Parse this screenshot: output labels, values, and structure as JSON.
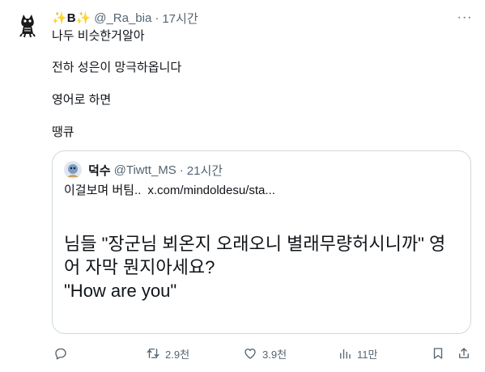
{
  "tweet": {
    "author": {
      "name": "B",
      "handle": "@_Ra_bia",
      "time": "17시간"
    },
    "lines": [
      "나두 비슷한거알아",
      "전하 성은이 망극하옵니다",
      "영어로 하면",
      "땡큐"
    ],
    "quote": {
      "author": {
        "name": "덕수",
        "handle": "@Tiwtt_MS",
        "time": "21시간"
      },
      "text": "이걸보며 버팀..",
      "link": "x.com/mindoldesu/sta...",
      "card_line1": "님들 \"장군님 뵈온지 오래오니 별래무량허시니까\" 영어 자막 뭔지아세요?",
      "card_line2": "\"How are you\""
    },
    "actions": {
      "reply": {
        "icon": "reply-icon",
        "count": ""
      },
      "retweet": {
        "icon": "retweet-icon",
        "count": "2.9천"
      },
      "like": {
        "icon": "heart-icon",
        "count": "3.9천"
      },
      "views": {
        "icon": "views-icon",
        "count": "11만"
      },
      "bookmark": {
        "icon": "bookmark-icon",
        "count": ""
      },
      "share": {
        "icon": "share-icon",
        "count": ""
      }
    }
  },
  "colors": {
    "text": "#0f1419",
    "secondary": "#536471",
    "border": "#cfd9de",
    "sparkle": "#f4c20d"
  }
}
